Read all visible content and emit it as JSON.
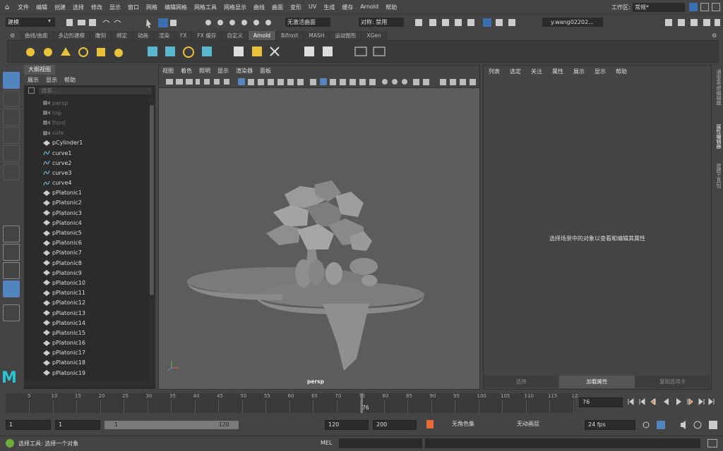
{
  "menubar": {
    "items": [
      "文件",
      "编辑",
      "创建",
      "选择",
      "修改",
      "显示",
      "窗口",
      "网格",
      "编辑网格",
      "网格工具",
      "网格显示",
      "曲线",
      "曲面",
      "变形",
      "UV",
      "生成",
      "缓存",
      "Arnold",
      "帮助"
    ],
    "workspace_label": "工作区:",
    "workspace_value": "常规*"
  },
  "toolbar": {
    "mode_value": "建模",
    "live_surface": "无激活曲面",
    "symmetry": "对称: 禁用",
    "user": "y.wang02202..."
  },
  "shelf": {
    "tabs": [
      "曲线/曲面",
      "多边形建模",
      "雕刻",
      "绑定",
      "动画",
      "渲染",
      "FX",
      "FX 缓存",
      "自定义",
      "Arnold",
      "Bifrost",
      "MASH",
      "运动图形",
      "XGen"
    ],
    "active_tab": "Arnold"
  },
  "outliner": {
    "title": "大纲视图",
    "menu": [
      "展示",
      "显示",
      "帮助"
    ],
    "search_placeholder": "搜索...",
    "items": [
      {
        "label": "persp",
        "type": "camera",
        "dim": true
      },
      {
        "label": "top",
        "type": "camera",
        "dim": true
      },
      {
        "label": "front",
        "type": "camera",
        "dim": true
      },
      {
        "label": "side",
        "type": "camera",
        "dim": true
      },
      {
        "label": "pCylinder1",
        "type": "mesh",
        "dim": false
      },
      {
        "label": "curve1",
        "type": "curve",
        "dim": false
      },
      {
        "label": "curve2",
        "type": "curve",
        "dim": false
      },
      {
        "label": "curve3",
        "type": "curve",
        "dim": false
      },
      {
        "label": "curve4",
        "type": "curve",
        "dim": false
      },
      {
        "label": "pPlatonic1",
        "type": "mesh",
        "dim": false
      },
      {
        "label": "pPlatonic2",
        "type": "mesh",
        "dim": false
      },
      {
        "label": "pPlatonic3",
        "type": "mesh",
        "dim": false
      },
      {
        "label": "pPlatonic4",
        "type": "mesh",
        "dim": false
      },
      {
        "label": "pPlatonic5",
        "type": "mesh",
        "dim": false
      },
      {
        "label": "pPlatonic6",
        "type": "mesh",
        "dim": false
      },
      {
        "label": "pPlatonic7",
        "type": "mesh",
        "dim": false
      },
      {
        "label": "pPlatonic8",
        "type": "mesh",
        "dim": false
      },
      {
        "label": "pPlatonic9",
        "type": "mesh",
        "dim": false
      },
      {
        "label": "pPlatonic10",
        "type": "mesh",
        "dim": false
      },
      {
        "label": "pPlatonic11",
        "type": "mesh",
        "dim": false
      },
      {
        "label": "pPlatonic12",
        "type": "mesh",
        "dim": false
      },
      {
        "label": "pPlatonic13",
        "type": "mesh",
        "dim": false
      },
      {
        "label": "pPlatonic14",
        "type": "mesh",
        "dim": false
      },
      {
        "label": "pPlatonic15",
        "type": "mesh",
        "dim": false
      },
      {
        "label": "pPlatonic16",
        "type": "mesh",
        "dim": false
      },
      {
        "label": "pPlatonic17",
        "type": "mesh",
        "dim": false
      },
      {
        "label": "pPlatonic18",
        "type": "mesh",
        "dim": false
      },
      {
        "label": "pPlatonic19",
        "type": "mesh",
        "dim": false
      }
    ]
  },
  "viewport": {
    "menu": [
      "视图",
      "着色",
      "照明",
      "显示",
      "渲染器",
      "面板"
    ],
    "camera": "persp"
  },
  "attribute_editor": {
    "menu": [
      "列表",
      "选定",
      "关注",
      "属性",
      "展示",
      "显示",
      "帮助"
    ],
    "hint": "选择场景中的对象以查看和编辑其属性",
    "buttons": [
      "选择",
      "加载属性",
      "复制选项卡"
    ]
  },
  "right_tabs": [
    "通道盒/层编辑器",
    "属性编辑器",
    "建模工具包"
  ],
  "timeline": {
    "ticks": [
      "5",
      "10",
      "15",
      "20",
      "25",
      "30",
      "35",
      "40",
      "45",
      "50",
      "55",
      "60",
      "65",
      "70",
      "75",
      "80",
      "85",
      "90",
      "95",
      "100",
      "105",
      "110",
      "115",
      "12"
    ],
    "current_frame": "76"
  },
  "range": {
    "start": "1",
    "start_inner": "1",
    "slider_start": "1",
    "slider_end": "120",
    "end_inner": "120",
    "end": "200",
    "char_set": "无角色集",
    "anim_layer": "无动画层",
    "fps": "24 fps"
  },
  "status": {
    "help_text": "选择工具: 选择一个对象",
    "mel_label": "MEL"
  }
}
